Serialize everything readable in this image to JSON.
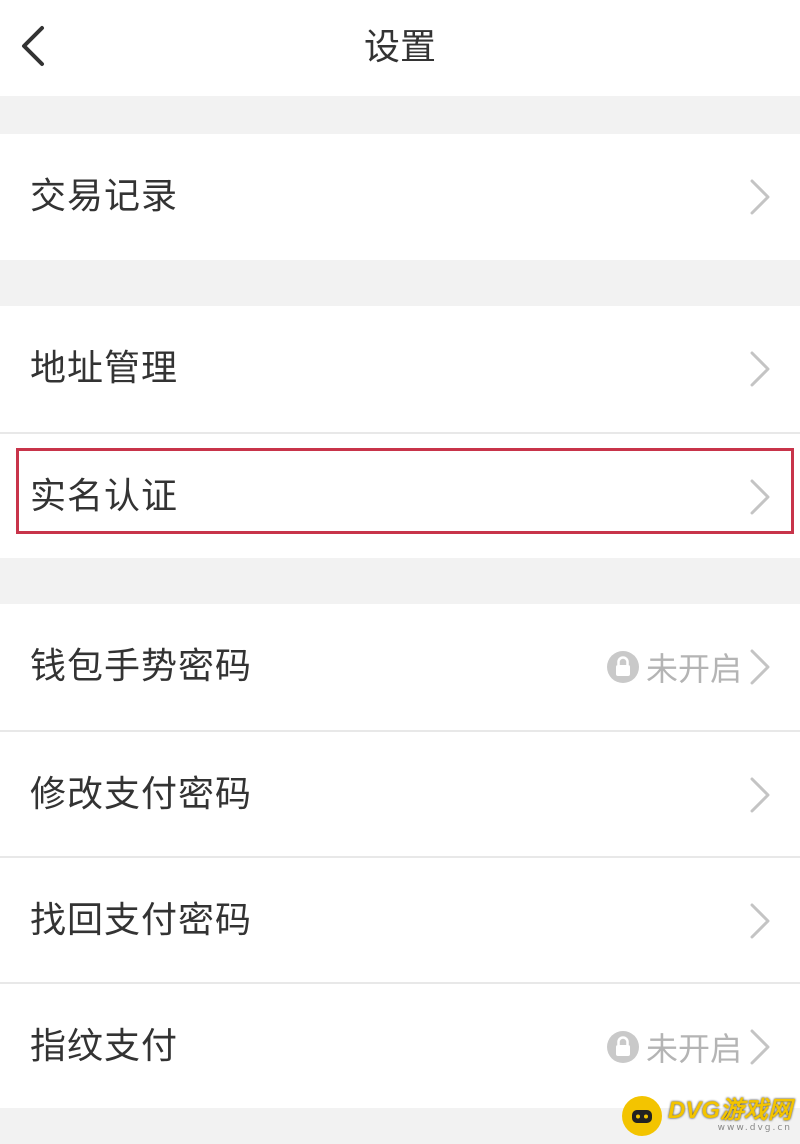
{
  "header": {
    "title": "设置",
    "back_icon": "chevron-left-icon"
  },
  "groups": [
    {
      "items": [
        {
          "label": "交易记录"
        }
      ]
    },
    {
      "items": [
        {
          "label": "地址管理"
        },
        {
          "label": "实名认证",
          "highlighted": true
        }
      ]
    },
    {
      "items": [
        {
          "label": "钱包手势密码",
          "status": "未开启",
          "status_icon": "lock-icon"
        },
        {
          "label": "修改支付密码"
        },
        {
          "label": "找回支付密码"
        },
        {
          "label": "指纹支付",
          "status": "未开启",
          "status_icon": "lock-icon"
        }
      ]
    }
  ],
  "watermark": {
    "text": "DVG游戏网",
    "sub": "www.dvg.cn"
  },
  "colors": {
    "background": "#f2f2f2",
    "row": "#ffffff",
    "text": "#333333",
    "muted": "#b4b4b4",
    "highlight_border": "#c8344a"
  }
}
